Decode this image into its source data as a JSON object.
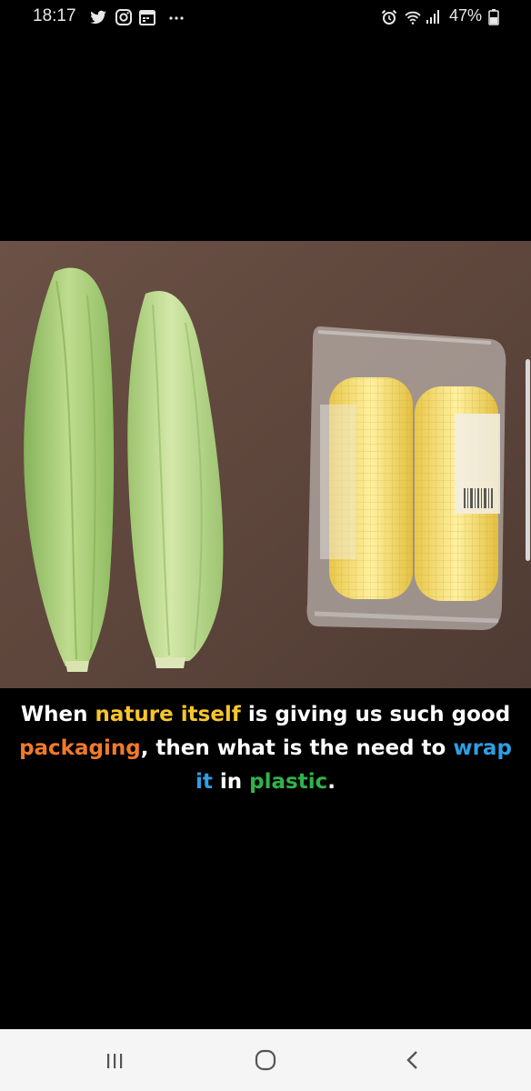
{
  "status_bar": {
    "time": "18:17",
    "battery": "47%",
    "left_icons": [
      "twitter-icon",
      "instagram-icon",
      "calendar-icon",
      "more-dots-icon"
    ],
    "right_icons": [
      "alarm-icon",
      "wifi-icon",
      "signal-icon",
      "battery-icon"
    ]
  },
  "image": {
    "subject": "corn-cobs-husk-vs-plastic-photo"
  },
  "caption": {
    "line1": [
      {
        "text": "When ",
        "color": "#ffffff"
      },
      {
        "text": "nature itself",
        "color": "#f7c52b"
      },
      {
        "text": " is giving us such good",
        "color": "#ffffff"
      }
    ],
    "line2": [
      {
        "text": "packaging",
        "color": "#f07a2a"
      },
      {
        "text": ", then what is the need to ",
        "color": "#ffffff"
      },
      {
        "text": "wrap",
        "color": "#2f9ee3"
      }
    ],
    "line3": [
      {
        "text": "it",
        "color": "#2f9ee3"
      },
      {
        "text": " in ",
        "color": "#ffffff"
      },
      {
        "text": "plastic",
        "color": "#2fb34a"
      },
      {
        "text": ".",
        "color": "#ffffff"
      }
    ]
  },
  "nav_bar": {
    "buttons": [
      "recents-icon",
      "home-icon",
      "back-icon"
    ]
  }
}
